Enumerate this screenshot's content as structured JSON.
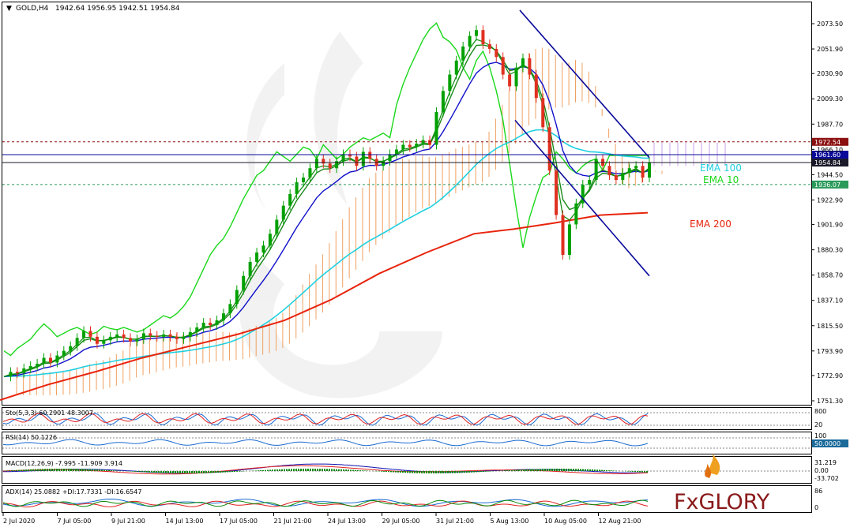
{
  "header": {
    "symbol": "GOLD,H4",
    "ohlc": "1942.64 1956.95 1942.51 1954.84"
  },
  "colors": {
    "bull_candle": "#00a000",
    "bear_candle": "#e03020",
    "ema10": "#0a8a0a",
    "ema100": "#20d0e0",
    "ema200": "#e8240c",
    "chikou": "#1ad81a",
    "kijun": "#1010cc",
    "tenkan": "#1a8a1a",
    "cloud_up": "#f0a060",
    "cloud_down": "#c8a0e8",
    "channel": "#0a0a9a"
  },
  "chart_data": [
    {
      "type": "line",
      "title": "GOLD,H4",
      "ylim": [
        1751.3,
        2085
      ],
      "y_ticks": [
        "2073.50",
        "2051.90",
        "2030.90",
        "2009.30",
        "1987.70",
        "1966.10",
        "1944.50",
        "1922.90",
        "1901.90",
        "1880.30",
        "1858.70",
        "1837.10",
        "1815.50",
        "1793.90",
        "1772.90",
        "1751.30"
      ],
      "x_ticks": [
        "2 Jul 2020",
        "7 Jul 05:00",
        "9 Jul 21:00",
        "14 Jul 13:00",
        "17 Jul 05:00",
        "21 Jul 21:00",
        "24 Jul 13:00",
        "29 Jul 05:00",
        "31 Jul 21:00",
        "5 Aug 13:00",
        "10 Aug 05:00",
        "12 Aug 21:00"
      ],
      "price_labels": [
        {
          "value": "1972.54",
          "color": "#8b1010"
        },
        {
          "value": "1961.60",
          "color": "#0a0a9a"
        },
        {
          "value": "1954.84",
          "color": "#1a1a2a"
        },
        {
          "value": "1936.07",
          "color": "#2a9a5a"
        }
      ],
      "horizontal_levels": [
        1972.54,
        1961.6,
        1954.84,
        1936.07
      ],
      "annotations": [
        "EMA 100",
        "EMA 10",
        "EMA 200"
      ],
      "close_series": [
        1772,
        1776,
        1775,
        1779,
        1781,
        1783,
        1788,
        1784,
        1790,
        1794,
        1798,
        1805,
        1811,
        1806,
        1800,
        1803,
        1806,
        1808,
        1805,
        1802,
        1804,
        1809,
        1807,
        1806,
        1808,
        1806,
        1804,
        1806,
        1810,
        1814,
        1818,
        1816,
        1820,
        1826,
        1834,
        1846,
        1858,
        1870,
        1878,
        1884,
        1894,
        1906,
        1918,
        1928,
        1938,
        1942,
        1950,
        1958,
        1954,
        1950,
        1956,
        1962,
        1960,
        1952,
        1964,
        1958,
        1952,
        1956,
        1962,
        1966,
        1970,
        1968,
        1971,
        1974,
        1970,
        1998,
        2016,
        2030,
        2042,
        2054,
        2063,
        2068,
        2056,
        2052,
        2045,
        2030,
        2020,
        2036,
        2044,
        2030,
        2010,
        1985,
        1948,
        1910,
        1876,
        1902,
        1920,
        1936,
        1940,
        1958,
        1952,
        1944,
        1940,
        1946,
        1950,
        1952,
        1942,
        1954.84
      ],
      "ema200_points": [
        [
          0,
          1752
        ],
        [
          60,
          1765
        ],
        [
          120,
          1776
        ],
        [
          180,
          1788
        ],
        [
          240,
          1798
        ],
        [
          300,
          1808
        ],
        [
          360,
          1820
        ],
        [
          420,
          1838
        ],
        [
          480,
          1860
        ],
        [
          540,
          1878
        ],
        [
          600,
          1894
        ],
        [
          650,
          1898
        ],
        [
          700,
          1903
        ],
        [
          760,
          1910
        ],
        [
          820,
          1912
        ]
      ]
    },
    {
      "type": "line",
      "title": "Sto(5,3,3)",
      "main": "60.2901",
      "signal": "48.3007",
      "levels": [
        20,
        80
      ]
    },
    {
      "type": "line",
      "title": "RSI(14)",
      "value": "50.1226",
      "label": "50.0000",
      "levels": [
        30,
        70
      ]
    },
    {
      "type": "bar",
      "title": "MACD(12,26,9)",
      "main": "-7.995",
      "signal": "-11.909",
      "hist": "3.914",
      "y_ticks": [
        "31.219",
        "0.00",
        "-33.702"
      ]
    },
    {
      "type": "line",
      "title": "ADX(14)",
      "adx": "25.0882",
      "plus_di": "+DI:17.7331",
      "minus_di": "-DI:16.6547",
      "y_ticks": [
        "86",
        "0"
      ]
    }
  ],
  "panels": {
    "sto": {
      "label": "Sto(5,3,3) 60.2901 48.3007",
      "ticks": [
        "800",
        "20"
      ]
    },
    "rsi": {
      "label": "RSI(14) 50.1226",
      "ticks": [
        "100",
        "50.0000"
      ]
    },
    "macd": {
      "label": "MACD(12,26,9) -7.995 -11.909 3.914",
      "ticks": [
        "31.219",
        "0.00",
        "-33.702"
      ]
    },
    "adx": {
      "label": "ADX(14) 25.0882 +DI:17.7331 -DI:16.6547",
      "ticks": [
        "86",
        "0"
      ]
    }
  },
  "logo": {
    "brand": "FxGLORY"
  }
}
